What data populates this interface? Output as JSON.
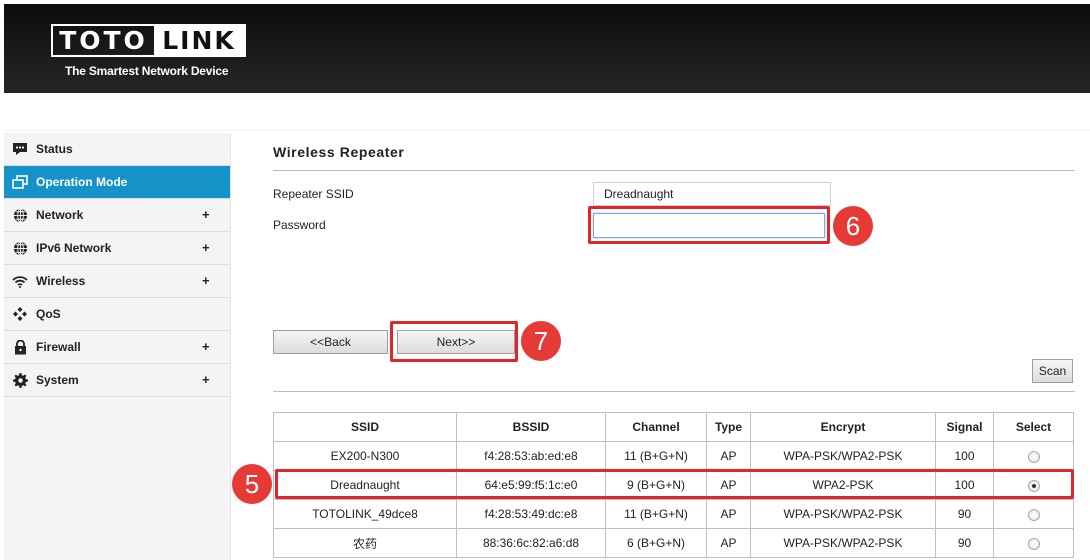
{
  "brand": {
    "logo_left": "TOTO",
    "logo_right": "LINK",
    "tagline": "The Smartest Network Device"
  },
  "sidebar": {
    "items": [
      {
        "label": "Status",
        "icon": "status-icon",
        "has_submenu": false
      },
      {
        "label": "Operation Mode",
        "icon": "operation-mode-icon",
        "has_submenu": false,
        "active": true
      },
      {
        "label": "Network",
        "icon": "globe-icon",
        "has_submenu": true
      },
      {
        "label": "IPv6 Network",
        "icon": "globe-icon",
        "has_submenu": true
      },
      {
        "label": "Wireless",
        "icon": "wifi-icon",
        "has_submenu": true
      },
      {
        "label": "QoS",
        "icon": "qos-icon",
        "has_submenu": false
      },
      {
        "label": "Firewall",
        "icon": "lock-icon",
        "has_submenu": true
      },
      {
        "label": "System",
        "icon": "gear-icon",
        "has_submenu": true
      }
    ],
    "plus": "+"
  },
  "page": {
    "title": "Wireless Repeater",
    "ssid_label": "Repeater SSID",
    "ssid_value": "Dreadnaught",
    "password_label": "Password",
    "password_value": "",
    "back_label": "<<Back",
    "next_label": "Next>>",
    "scan_label": "Scan"
  },
  "callouts": {
    "step_6": "6",
    "step_7": "7",
    "step_5": "5"
  },
  "table": {
    "headers": [
      "SSID",
      "BSSID",
      "Channel",
      "Type",
      "Encrypt",
      "Signal",
      "Select"
    ],
    "rows": [
      {
        "ssid": "EX200-N300",
        "bssid": "f4:28:53:ab:ed:e8",
        "channel": "11 (B+G+N)",
        "type": "AP",
        "encrypt": "WPA-PSK/WPA2-PSK",
        "signal": "100",
        "selected": false
      },
      {
        "ssid": "Dreadnaught",
        "bssid": "64:e5:99:f5:1c:e0",
        "channel": "9 (B+G+N)",
        "type": "AP",
        "encrypt": "WPA2-PSK",
        "signal": "100",
        "selected": true
      },
      {
        "ssid": "TOTOLINK_49dce8",
        "bssid": "f4:28:53:49:dc:e8",
        "channel": "11 (B+G+N)",
        "type": "AP",
        "encrypt": "WPA-PSK/WPA2-PSK",
        "signal": "90",
        "selected": false
      },
      {
        "ssid": "农药",
        "bssid": "88:36:6c:82:a6:d8",
        "channel": "6 (B+G+N)",
        "type": "AP",
        "encrypt": "WPA-PSK/WPA2-PSK",
        "signal": "90",
        "selected": false
      }
    ]
  },
  "colors": {
    "header_bg": "#1a1a1a",
    "active_menu": "#1592c8",
    "highlight": "#e0262b",
    "callout": "#e63a36"
  }
}
